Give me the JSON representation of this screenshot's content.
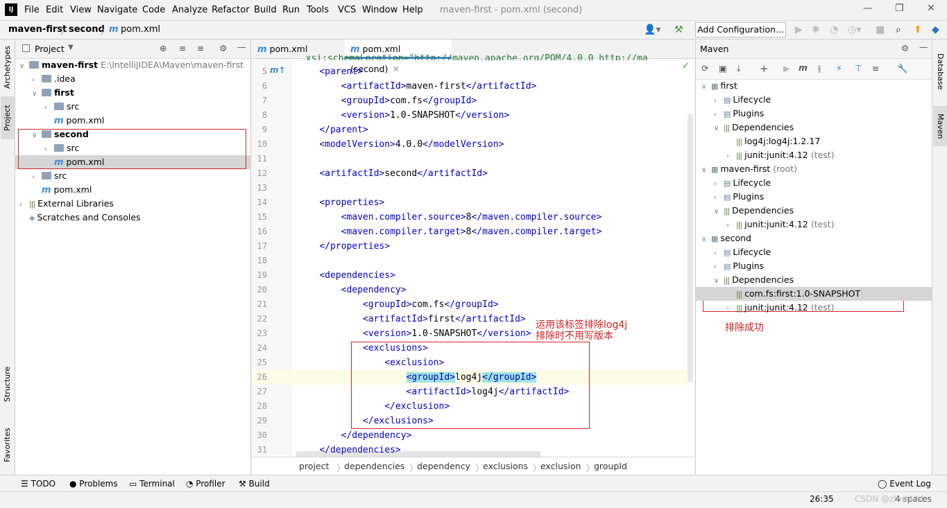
{
  "menubar": {
    "logo": "IJ",
    "items": [
      "File",
      "Edit",
      "View",
      "Navigate",
      "Code",
      "Analyze",
      "Refactor",
      "Build",
      "Run",
      "Tools",
      "VCS",
      "Window",
      "Help"
    ],
    "window_title": "maven-first - pom.xml (second)"
  },
  "navbar": {
    "crumbs": [
      "maven-first",
      "second",
      "pom.xml"
    ],
    "add_config": "Add Configuration..."
  },
  "left_stripe": [
    "Archetypes",
    "Project",
    "Structure",
    "Favorites"
  ],
  "right_stripe": [
    "Database",
    "Maven"
  ],
  "project": {
    "header": "Project",
    "tree": [
      {
        "label": "maven-first",
        "path": "E:\\IntelliJIDEA\\Maven\\maven-first"
      },
      {
        "label": ".idea"
      },
      {
        "label": "first"
      },
      {
        "label": "src"
      },
      {
        "label": "pom.xml"
      },
      {
        "label": "second"
      },
      {
        "label": "src"
      },
      {
        "label": "pom.xml"
      },
      {
        "label": "src"
      },
      {
        "label": "pom.xml"
      },
      {
        "label": "External Libraries"
      },
      {
        "label": "Scratches and Consoles"
      }
    ]
  },
  "editor": {
    "tabs": [
      "pom.xml (first)",
      "pom.xml (second)"
    ],
    "lines": [
      {
        "n": "5",
        "text": "    <parent>"
      },
      {
        "n": "6",
        "text": "        <artifactId>maven-first</artifactId>"
      },
      {
        "n": "7",
        "text": "        <groupId>com.fs</groupId>"
      },
      {
        "n": "8",
        "text": "        <version>1.0-SNAPSHOT</version>"
      },
      {
        "n": "9",
        "text": "    </parent>"
      },
      {
        "n": "10",
        "text": "    <modelVersion>4.0.0</modelVersion>"
      },
      {
        "n": "11",
        "text": ""
      },
      {
        "n": "12",
        "text": "    <artifactId>second</artifactId>"
      },
      {
        "n": "13",
        "text": ""
      },
      {
        "n": "14",
        "text": "    <properties>"
      },
      {
        "n": "15",
        "text": "        <maven.compiler.source>8</maven.compiler.source>"
      },
      {
        "n": "16",
        "text": "        <maven.compiler.target>8</maven.compiler.target>"
      },
      {
        "n": "17",
        "text": "    </properties>"
      },
      {
        "n": "18",
        "text": ""
      },
      {
        "n": "19",
        "text": "    <dependencies>"
      },
      {
        "n": "20",
        "text": "        <dependency>"
      },
      {
        "n": "21",
        "text": "            <groupId>com.fs</groupId>"
      },
      {
        "n": "22",
        "text": "            <artifactId>first</artifactId>"
      },
      {
        "n": "23",
        "text": "            <version>1.0-SNAPSHOT</version>"
      },
      {
        "n": "24",
        "text": "            <exclusions>"
      },
      {
        "n": "25",
        "text": "                <exclusion>"
      },
      {
        "n": "26",
        "text": "                    <groupId>log4j</groupId>"
      },
      {
        "n": "27",
        "text": "                    <artifactId>log4j</artifactId>"
      },
      {
        "n": "28",
        "text": "                </exclusion>"
      },
      {
        "n": "29",
        "text": "            </exclusions>"
      },
      {
        "n": "30",
        "text": "        </dependency>"
      },
      {
        "n": "31",
        "text": "    </dependencies>"
      }
    ],
    "top_partial": "  xsi:schemaLocation=\"http://maven.apache.org/POM/4.0.0 http://ma",
    "annotation_1": "运用该标签排除log4j",
    "annotation_2": "排除时不用写版本",
    "breadcrumbs": [
      "project",
      "dependencies",
      "dependency",
      "exclusions",
      "exclusion",
      "groupId"
    ]
  },
  "maven": {
    "header": "Maven",
    "tree": [
      {
        "label": "first"
      },
      {
        "label": "Lifecycle"
      },
      {
        "label": "Plugins"
      },
      {
        "label": "Dependencies"
      },
      {
        "label": "log4j:log4j:1.2.17"
      },
      {
        "label": "junit:junit:4.12",
        "suffix": "(test)"
      },
      {
        "label": "maven-first",
        "suffix": "(root)"
      },
      {
        "label": "Lifecycle"
      },
      {
        "label": "Plugins"
      },
      {
        "label": "Dependencies"
      },
      {
        "label": "junit:junit:4.12",
        "suffix": "(test)"
      },
      {
        "label": "second"
      },
      {
        "label": "Lifecycle"
      },
      {
        "label": "Plugins"
      },
      {
        "label": "Dependencies"
      },
      {
        "label": "com.fs:first:1.0-SNAPSHOT"
      },
      {
        "label": "junit:junit:4.12",
        "suffix": "(test)"
      }
    ],
    "annotation": "排除成功"
  },
  "bottom_tabs": [
    "TODO",
    "Problems",
    "Terminal",
    "Profiler",
    "Build"
  ],
  "event_log": "Event Log",
  "status": {
    "caret": "26:35",
    "watermark": "CSDN @zlow444",
    "indent": "4 spaces"
  },
  "colors": {
    "tag": "#0000c8",
    "annotation": "#d21f1f",
    "highlight": "#9fe3e3",
    "selection": "#d5d5d5"
  }
}
